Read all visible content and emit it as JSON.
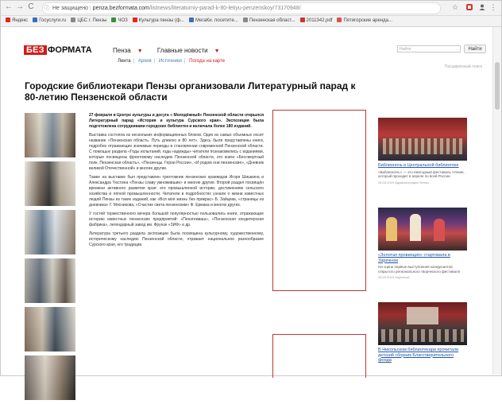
{
  "browser": {
    "back": "←",
    "forward": "→",
    "reload": "C",
    "url_info": "ⓘ",
    "url_security": "Не защищено",
    "url_host": "penza.bezformata.com",
    "url_path": "/listnews/literaturniy-parad-k-80-letiyu-penzenskoy/73170948/",
    "star": "☆",
    "menu": "⋮",
    "bookmarks": [
      {
        "label": "Яндекс",
        "color": "#e52620"
      },
      {
        "label": "Госуслуги.ru",
        "color": "#3b6fb6"
      },
      {
        "label": "ЦБС г. Пензы",
        "color": "#888888"
      },
      {
        "label": "ЧОЗ",
        "color": "#3a8f3a"
      },
      {
        "label": "Культура пензы (ф...",
        "color": "#e52620"
      },
      {
        "label": "МегаКи. посетите...",
        "color": "#3b6fb6"
      },
      {
        "label": "Пензенская област...",
        "color": "#888888"
      },
      {
        "label": "2011342.pdf",
        "color": "#cc3333"
      },
      {
        "label": "Пятигорские аренда...",
        "color": "#d9534f"
      }
    ]
  },
  "site": {
    "logo_red": "БЕЗ",
    "logo_black": "ФОРМАТА",
    "nav": [
      {
        "label": "Пенза",
        "caret": "▼"
      },
      {
        "label": "Главные новости",
        "caret": "▼"
      }
    ],
    "subnav": [
      "Лента",
      "Архив",
      "Источники",
      "Погода на карте"
    ],
    "search_placeholder": "Найти",
    "search_button": "Найти",
    "advanced_search": "Расширенный поиск"
  },
  "article": {
    "title": "Городские библиотекари Пензы организовали Литературный парад к 80-летию Пензенской области",
    "paragraphs": [
      {
        "lead": true,
        "text": "27 февраля в Центре культуры и досуга « Молодёжный» Пензенской области открылся Литературный парад «История и культура Сурского края». Экспозиция была подготовлена сотрудниками городских библиотек и включала более 180 изданий."
      },
      {
        "text": "Выставка состояла из нескольких информационных блоков. Один из самых объемных носит название «Пензенская область. Путь длиною в 80 лет». Здесь были представлены книги, подробно отражающие значимые периоды в становлении современной Пензенской области. С помощью раздела «Годы испытаний, годы надежды» читатели познакомились с изданиями, которые посвящены фронтовому наследию Пензенской области, это книги «Бессмертный полк. Пензенская область», «Пензенцы. Герои России», «И родом они пензенские», «Дневник великой Отечественной» и многие другие."
      },
      {
        "text": "Также на выставке был представлен трехтомник пензенских краеведов Игоря Шишкина и Александра Тюстина «Пензы славу умножившие» и многие другие. Второй раздел посвящён времени активного развития края: его промышленной истории, достижениям сельского хозяйства и лёгкой промышленности. Читатели в подробностях узнали о жизни известных людей Пензы из таких изданий, как «Вся моя жизнь без прикрас» Б. Зайцева, «страницы из дневника» Г. Мясникова, «Счастие света пензенским» Ф. Ермака и многих других."
      },
      {
        "text": "У гостей торжественного вечера большой популярностью пользовались книги, отражающие историю известных пензенских предприятий: «Пензтекмаш», «Пензенская кондитерская фабрика», легендарный завод им. Фрунзе «ЗИФ» и др."
      },
      {
        "text": "Литература третьего раздела экспозиции была посвящена культурному, художественному, историческому наследию Пензенской области, отражает национальное разнообразие Сурского края, его традиции."
      }
    ]
  },
  "sidebar": [
    {
      "title": "Библионочь в Центральной библиотеке",
      "desc": "«Библионочь» — это ежегодный фестиваль чтения, который проходит в апреле по всей России",
      "date": "26.03.2019 Администрация Пензы"
    },
    {
      "title": "«Золотая провинция» стартовала в Заречном",
      "desc": "На сцене первые выступления конкурсантов открытого регионального творческого фестиваля",
      "date": "26.03.2019 Заречный"
    },
    {
      "title": "В Никольском библиотекари прочитали детский сборник Благотворительного фонда",
      "desc": "",
      "date": ""
    }
  ]
}
